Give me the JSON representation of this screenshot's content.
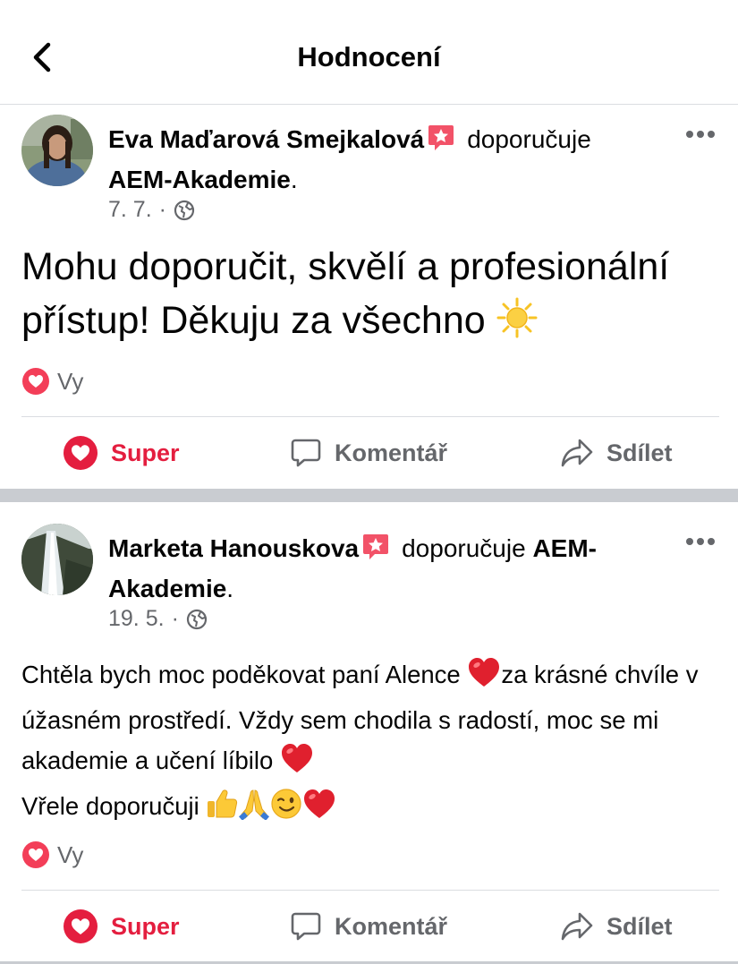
{
  "header": {
    "title": "Hodnocení"
  },
  "posts": [
    {
      "author": "Eva Maďarová Smejkalová",
      "verb": "doporučuje",
      "page": "AEM-Akademie",
      "date": "7. 7.",
      "text": "Mohu doporučit, skvělí a profesionální přístup! Děkuju za všechno",
      "text_emoji": "sun",
      "reactions": "Vy",
      "actions": {
        "like": "Super",
        "comment": "Komentář",
        "share": "Sdílet"
      }
    },
    {
      "author": "Marketa Hanouskova",
      "verb": "doporučuje",
      "page": "AEM-Akademie",
      "date": "19. 5.",
      "lines": [
        "Chtěla bych moc poděkovat paní Alence",
        "za krásné chvíle v úžasném prostředí. Vždy sem chodila s radostí, moc se mi akademie a učení líbilo",
        "Vřele doporučuji"
      ],
      "emojis": [
        "heart",
        "heart",
        "thumbs-up",
        "folded-hands",
        "winking-face",
        "heart"
      ],
      "reactions": "Vy",
      "actions": {
        "like": "Super",
        "comment": "Komentář",
        "share": "Sdílet"
      }
    }
  ],
  "colors": {
    "accent_red": "#e41e3f",
    "secondary_text": "#65676b",
    "divider": "#dadde1",
    "separator": "#c9ccd1"
  }
}
